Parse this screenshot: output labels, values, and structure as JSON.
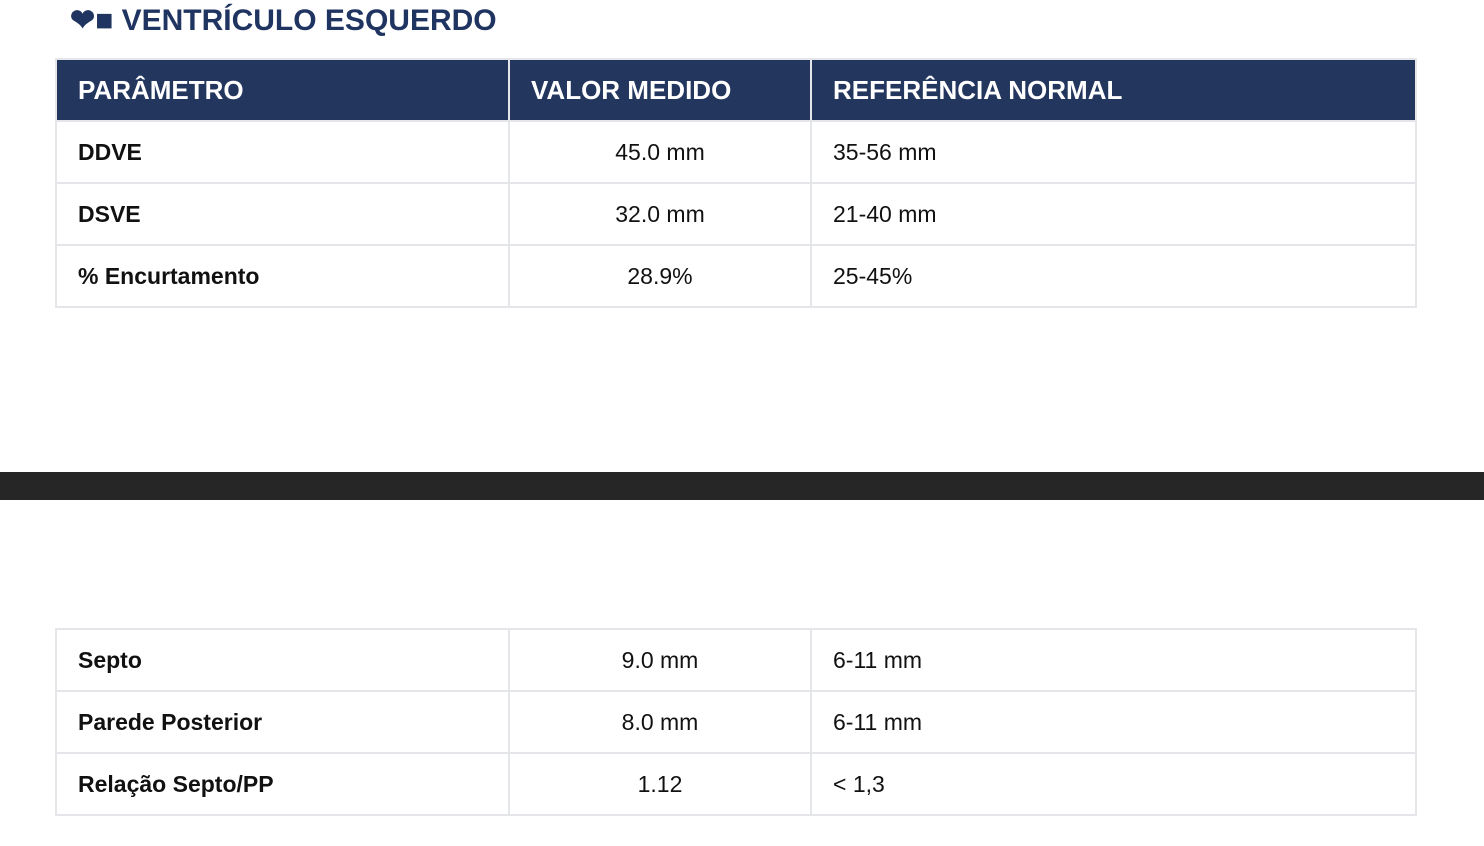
{
  "section": {
    "icon": "heart-icon",
    "title": "❤■ VENTRÍCULO ESQUERDO"
  },
  "table": {
    "headers": [
      "PARÂMETRO",
      "VALOR MEDIDO",
      "REFERÊNCIA NORMAL"
    ],
    "rows_page1": [
      {
        "param": "DDVE",
        "value": "45.0 mm",
        "ref": "35-56 mm"
      },
      {
        "param": "DSVE",
        "value": "32.0 mm",
        "ref": "21-40 mm"
      },
      {
        "param": "% Encurtamento",
        "value": "28.9%",
        "ref": "25-45%"
      }
    ],
    "rows_page2": [
      {
        "param": "Septo",
        "value": "9.0 mm",
        "ref": "6-11 mm"
      },
      {
        "param": "Parede Posterior",
        "value": "8.0 mm",
        "ref": "6-11 mm"
      },
      {
        "param": "Relação Septo/PP",
        "value": "1.12",
        "ref": "< 1,3"
      }
    ]
  },
  "colors": {
    "header_bg": "#23365e",
    "title_color": "#1f3460",
    "border": "#e4e6ea",
    "page_break": "#262626"
  }
}
